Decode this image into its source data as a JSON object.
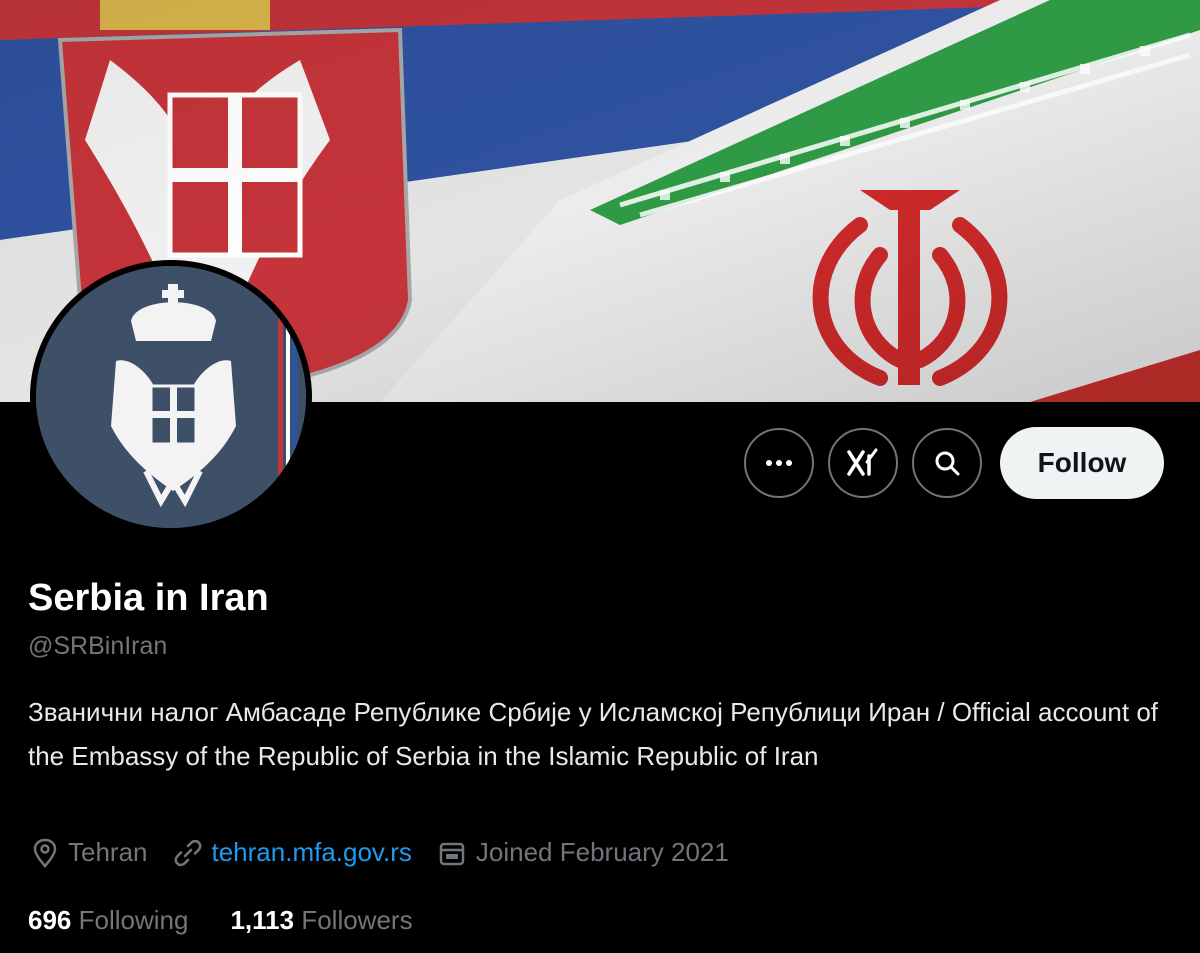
{
  "profile": {
    "name": "Serbia in Iran",
    "handle": "@SRBinIran",
    "bio": "Званични налог Амбасаде Републике Србије у Исламској Републици Иран / Official account of the Embassy of the Republic of Serbia in the Islamic Republic of Iran",
    "location": "Tehran",
    "website": "tehran.mfa.gov.rs",
    "joined": "Joined February 2021"
  },
  "actions": {
    "more_icon": "more-icon",
    "grok_icon": "grok-icon",
    "search_icon": "search-icon",
    "follow_label": "Follow"
  },
  "stats": {
    "following_count": "696",
    "following_label": "Following",
    "followers_count": "1,113",
    "followers_label": "Followers"
  },
  "colors": {
    "background": "#000000",
    "link": "#1d9bf0",
    "muted": "#71767b",
    "serbia_red": "#c6363c",
    "serbia_blue": "#0c4076",
    "iran_green": "#239f40",
    "iran_red": "#da0000"
  }
}
